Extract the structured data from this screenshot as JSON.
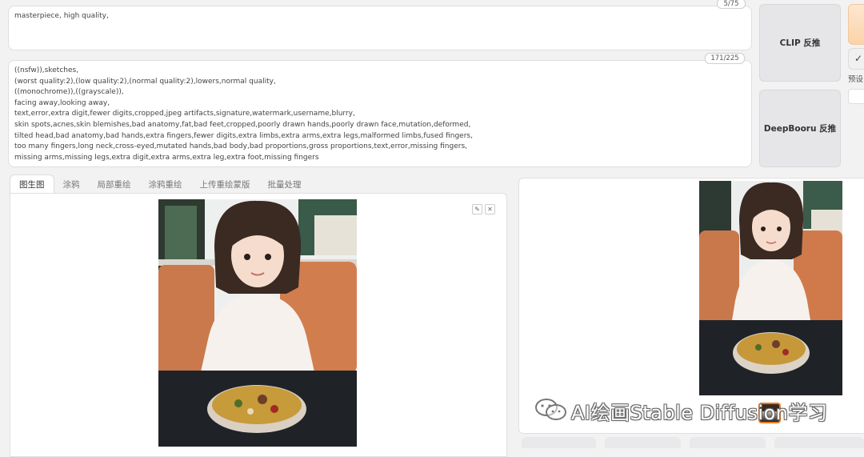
{
  "prompt": {
    "text": "masterpiece, high quality,",
    "token_count": "5/75"
  },
  "negative_prompt": {
    "text": "((nsfw)),sketches,\n(worst quality:2),(low quality:2),(normal quality:2),lowers,normal quality,\n((monochrome)),((grayscale)),\nfacing away,looking away,\ntext,error,extra digit,fewer digits,cropped,jpeg artifacts,signature,watermark,username,blurry,\nskin spots,acnes,skin blemishes,bad anatomy,fat,bad feet,cropped,poorly drawn hands,poorly drawn face,mutation,deformed,\ntilted head,bad anatomy,bad hands,extra fingers,fewer digits,extra limbs,extra arms,extra legs,malformed limbs,fused fingers,\ntoo many fingers,long neck,cross-eyed,mutated hands,bad body,bad proportions,gross proportions,text,error,missing fingers,\nmissing arms,missing legs,extra digit,extra arms,extra leg,extra foot,missing fingers",
    "token_count": "171/225"
  },
  "interrogate": {
    "clip_label": "CLIP 反推",
    "deepbooru_label": "DeepBooru 反推"
  },
  "right_edge": {
    "check_icon": "✓",
    "preset_label": "预设"
  },
  "tabs": [
    {
      "label": "图生图",
      "active": true
    },
    {
      "label": "涂鸦",
      "active": false
    },
    {
      "label": "局部重绘",
      "active": false
    },
    {
      "label": "涂鸦重绘",
      "active": false
    },
    {
      "label": "上传重绘蒙版",
      "active": false
    },
    {
      "label": "批量处理",
      "active": false
    }
  ],
  "input_image": {
    "edit_icon": "pencil-icon",
    "close_icon": "close-icon"
  },
  "watermark": {
    "text": "AI绘画Stable Diffusion学习",
    "icon": "wechat-icon"
  },
  "colors": {
    "accent_orange": "#f2781c",
    "generate_button": "#fde0c4"
  }
}
